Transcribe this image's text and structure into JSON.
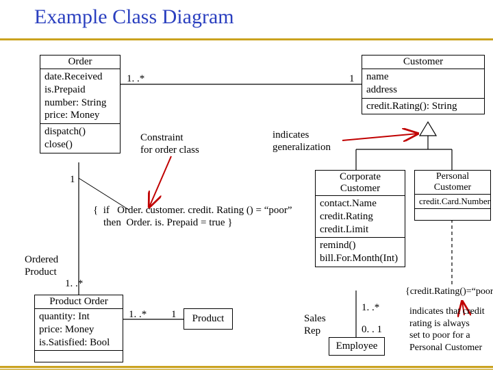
{
  "title": "Example Class Diagram",
  "order": {
    "name": "Order",
    "attrs": [
      "date.Received",
      "is.Prepaid",
      "number: String",
      "price: Money"
    ],
    "ops": [
      "dispatch()",
      "close()"
    ]
  },
  "customer": {
    "name": "Customer",
    "attrs": [
      "name",
      "address"
    ],
    "ops": [
      "credit.Rating(): String"
    ]
  },
  "corporate": {
    "name_l1": "Corporate",
    "name_l2": "Customer",
    "attrs": [
      "contact.Name",
      "credit.Rating",
      "credit.Limit"
    ],
    "ops": [
      "remind()",
      "bill.For.Month(Int)"
    ]
  },
  "personal": {
    "name_l1": "Personal",
    "name_l2": "Customer",
    "attrs": [
      "credit.Card.Number"
    ]
  },
  "productOrder": {
    "name": "Product Order",
    "attrs": [
      "quantity: Int",
      "price: Money",
      "is.Satisfied: Bool"
    ]
  },
  "orderedProductLabel_l1": "Ordered",
  "orderedProductLabel_l2": "Product",
  "product": {
    "name": "Product"
  },
  "employee": {
    "name": "Employee"
  },
  "salesRep_l1": "Sales",
  "salesRep_l2": "Rep",
  "constraintLabel_l1": "Constraint",
  "constraintLabel_l2": "for order class",
  "indicatesGen_l1": "indicates",
  "indicatesGen_l2": "generalization",
  "constraintText": "{  if   Order. customer. credit. Rating () = “poor”\n    then  Order. is. Prepaid = true }",
  "poorConstraint": "{credit.Rating()=“poor”}",
  "poorNote_l1": "indicates that credit",
  "poorNote_l2": "rating is always",
  "poorNote_l3": "set to poor for a",
  "poorNote_l4": "Personal Customer",
  "mult": {
    "order_customer_left": "1. .*",
    "order_customer_right": "1",
    "order_prodorder_top": "1",
    "order_prodorder_bot": "1. .*",
    "prodorder_product_left": "1. .*",
    "prodorder_product_right": "1",
    "corp_emp_top": "1. .*",
    "corp_emp_bot": "0. . 1"
  }
}
